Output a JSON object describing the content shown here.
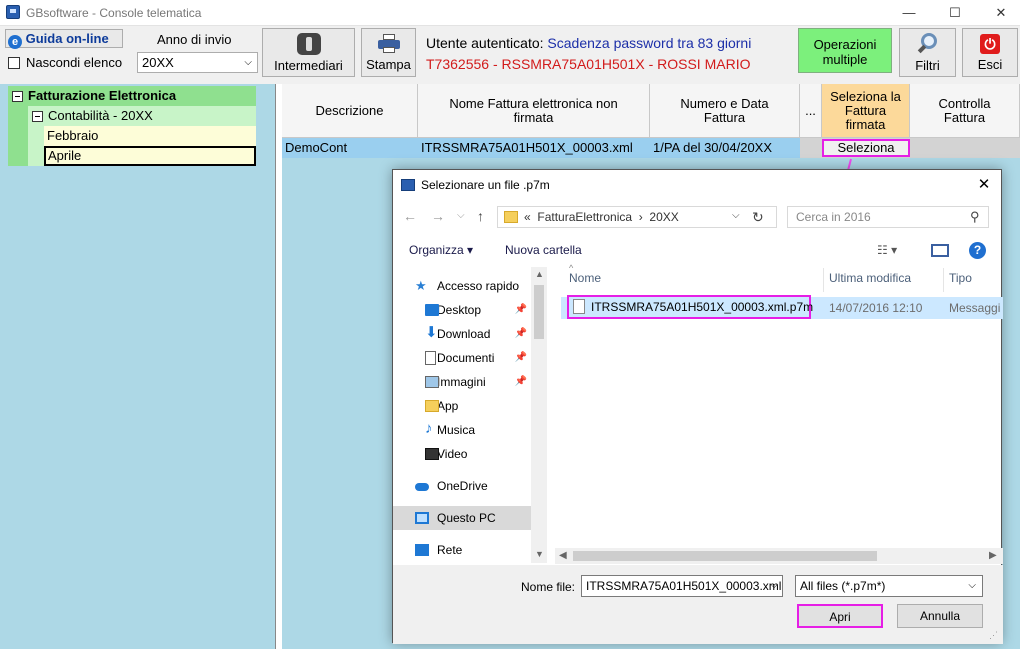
{
  "window": {
    "title": "GBsoftware - Console telematica",
    "min": "—",
    "max": "☐",
    "close": "✕"
  },
  "toolbar": {
    "help_label": "Guida on-line",
    "year_label": "Anno di invio",
    "hide_list_label": "Nascondi elenco",
    "year_value": "20XX",
    "intermediari_label": "Intermediari",
    "stampa_label": "Stampa",
    "user_label": "Utente autenticato:",
    "user_status": "Scadenza password tra 83 giorni",
    "user_id": "T7362556 - RSSMRA75A01H501X - ROSSI MARIO",
    "operazioni_line1": "Operazioni",
    "operazioni_line2": "multiple",
    "filtri_label": "Filtri",
    "esci_label": "Esci"
  },
  "tree": {
    "root": "Fatturazione Elettronica",
    "child": "Contabilità - 20XX",
    "months": [
      "Febbraio",
      "Aprile"
    ]
  },
  "grid": {
    "headers": {
      "descrizione": "Descrizione",
      "nome_line1": "Nome Fattura elettronica non",
      "nome_line2": "firmata",
      "numero_line1": "Numero e Data",
      "numero_line2": "Fattura",
      "dots": "...",
      "seleziona_line1": "Seleziona la",
      "seleziona_line2": "Fattura",
      "seleziona_line3": "firmata",
      "controlla_line1": "Controlla",
      "controlla_line2": "Fattura"
    },
    "row": {
      "descrizione": "DemoCont",
      "nome": "ITRSSMRA75A01H501X_00003.xml",
      "numero": "1/PA del 30/04/20XX",
      "seleziona_btn": "Seleziona"
    }
  },
  "dialog": {
    "title": "Selezionare un file .p7m",
    "close": "✕",
    "breadcrumb": {
      "prefix": "«",
      "folder1": "FatturaElettronica",
      "sep": "›",
      "folder2": "20XX"
    },
    "search_placeholder": "Cerca in 2016",
    "organizza": "Organizza ▾",
    "nuova_cartella": "Nuova cartella",
    "help": "?",
    "sidebar": [
      {
        "label": "Accesso rapido"
      },
      {
        "label": "Desktop"
      },
      {
        "label": "Download"
      },
      {
        "label": "Documenti"
      },
      {
        "label": "Immagini"
      },
      {
        "label": "App"
      },
      {
        "label": "Musica"
      },
      {
        "label": "Video"
      },
      {
        "label": "OneDrive"
      },
      {
        "label": "Questo PC"
      },
      {
        "label": "Rete"
      }
    ],
    "columns": {
      "nome": "Nome",
      "modifica": "Ultima modifica",
      "tipo": "Tipo"
    },
    "file": {
      "name": "ITRSSMRA75A01H501X_00003.xml.p7m",
      "date": "14/07/2016 12:10",
      "type": "Messaggi"
    },
    "filename_label": "Nome file:",
    "filename_value": "ITRSSMRA75A01H501X_00003.xml",
    "filter_value": "All files (*.p7m*)",
    "open_btn": "Apri",
    "cancel_btn": "Annulla"
  },
  "colors": {
    "highlight": "#e61ee6",
    "grid_bg": "#add8e6",
    "selected_row": "#9acfef",
    "tree_green": "#8fe08f",
    "operazioni_bg": "#7cf07c"
  }
}
